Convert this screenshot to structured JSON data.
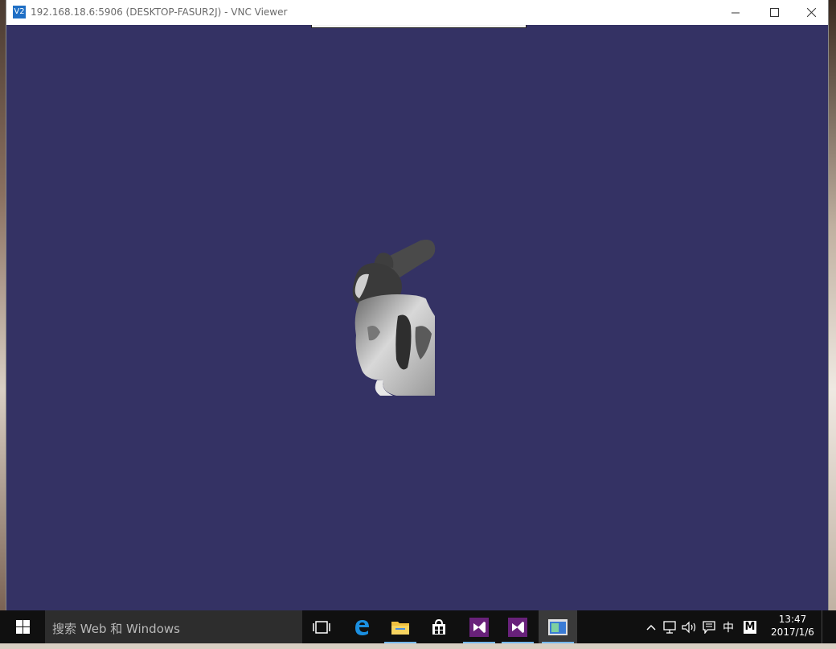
{
  "window": {
    "title": "192.168.18.6:5906 (DESKTOP-FASUR2J) - VNC Viewer",
    "app_icon_text": "V2",
    "controls": {
      "minimize": "minimize-icon",
      "maximize": "maximize-icon",
      "close": "close-icon"
    }
  },
  "remote": {
    "background_color": "#343264",
    "content": "3D rendered bunny model (partially clipped)"
  },
  "taskbar": {
    "search_placeholder": "搜索 Web 和 Windows",
    "apps": [
      {
        "name": "task-view",
        "icon": "task-view-icon"
      },
      {
        "name": "edge",
        "icon": "edge-icon"
      },
      {
        "name": "file-explorer",
        "icon": "folder-icon",
        "active": true
      },
      {
        "name": "store",
        "icon": "store-icon"
      },
      {
        "name": "visual-studio-1",
        "icon": "visual-studio-icon",
        "active": true
      },
      {
        "name": "visual-studio-2",
        "icon": "visual-studio-icon",
        "active": true
      },
      {
        "name": "vnc-viewer",
        "icon": "vnc-window-icon",
        "active": true,
        "focused": true
      }
    ],
    "tray": {
      "ime_label": "中",
      "m_label": "M"
    },
    "clock": {
      "time": "13:47",
      "date": "2017/1/6"
    }
  }
}
